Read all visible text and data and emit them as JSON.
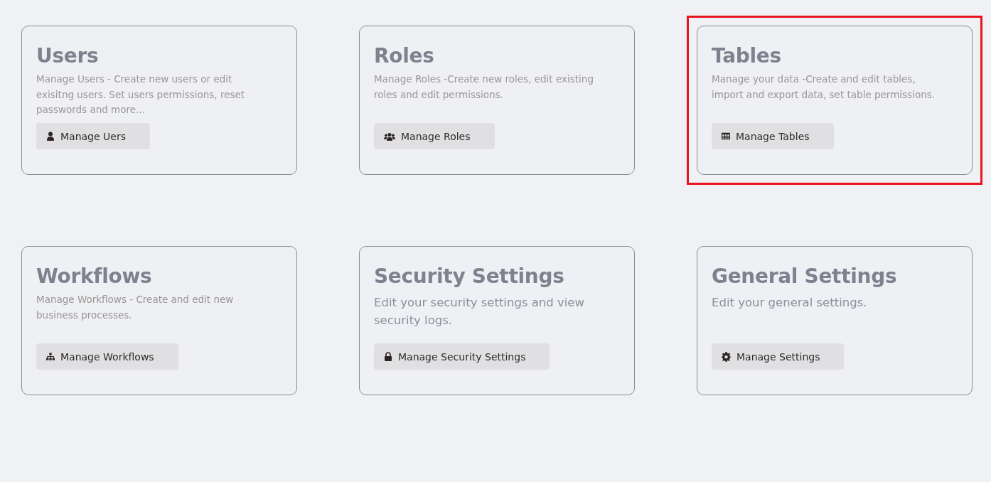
{
  "cards": [
    {
      "title": "Users",
      "description": "Manage Users - Create new users or edit exisitng users. Set users permissions, reset passwords and more...",
      "kind": "compact",
      "highlighted": false,
      "button": {
        "label": "Manage Uers",
        "kind": "user"
      }
    },
    {
      "title": "Roles",
      "description": "Manage Roles -Create new roles, edit existing roles and edit permissions.",
      "kind": "compact",
      "highlighted": false,
      "button": {
        "label": "Manage Roles",
        "kind": "users"
      }
    },
    {
      "title": "Tables",
      "description": "Manage your data -Create and edit tables, import and export data, set table permissions.",
      "kind": "compact",
      "highlighted": true,
      "button": {
        "label": "Manage Tables",
        "kind": "table"
      }
    },
    {
      "title": "Workflows",
      "description": "Manage Workflows - Create and edit new business processes.",
      "kind": "compact",
      "highlighted": false,
      "button": {
        "label": "Manage Workflows",
        "kind": "sitemap"
      }
    },
    {
      "title": "Security Settings",
      "description": "Edit your security settings and view security logs.",
      "kind": "large",
      "highlighted": false,
      "button": {
        "label": "Manage Security Settings",
        "kind": "lock"
      }
    },
    {
      "title": "General Settings",
      "description": "Edit  your general settings.",
      "kind": "large",
      "highlighted": false,
      "button": {
        "label": "Manage Settings",
        "kind": "gear"
      }
    }
  ]
}
